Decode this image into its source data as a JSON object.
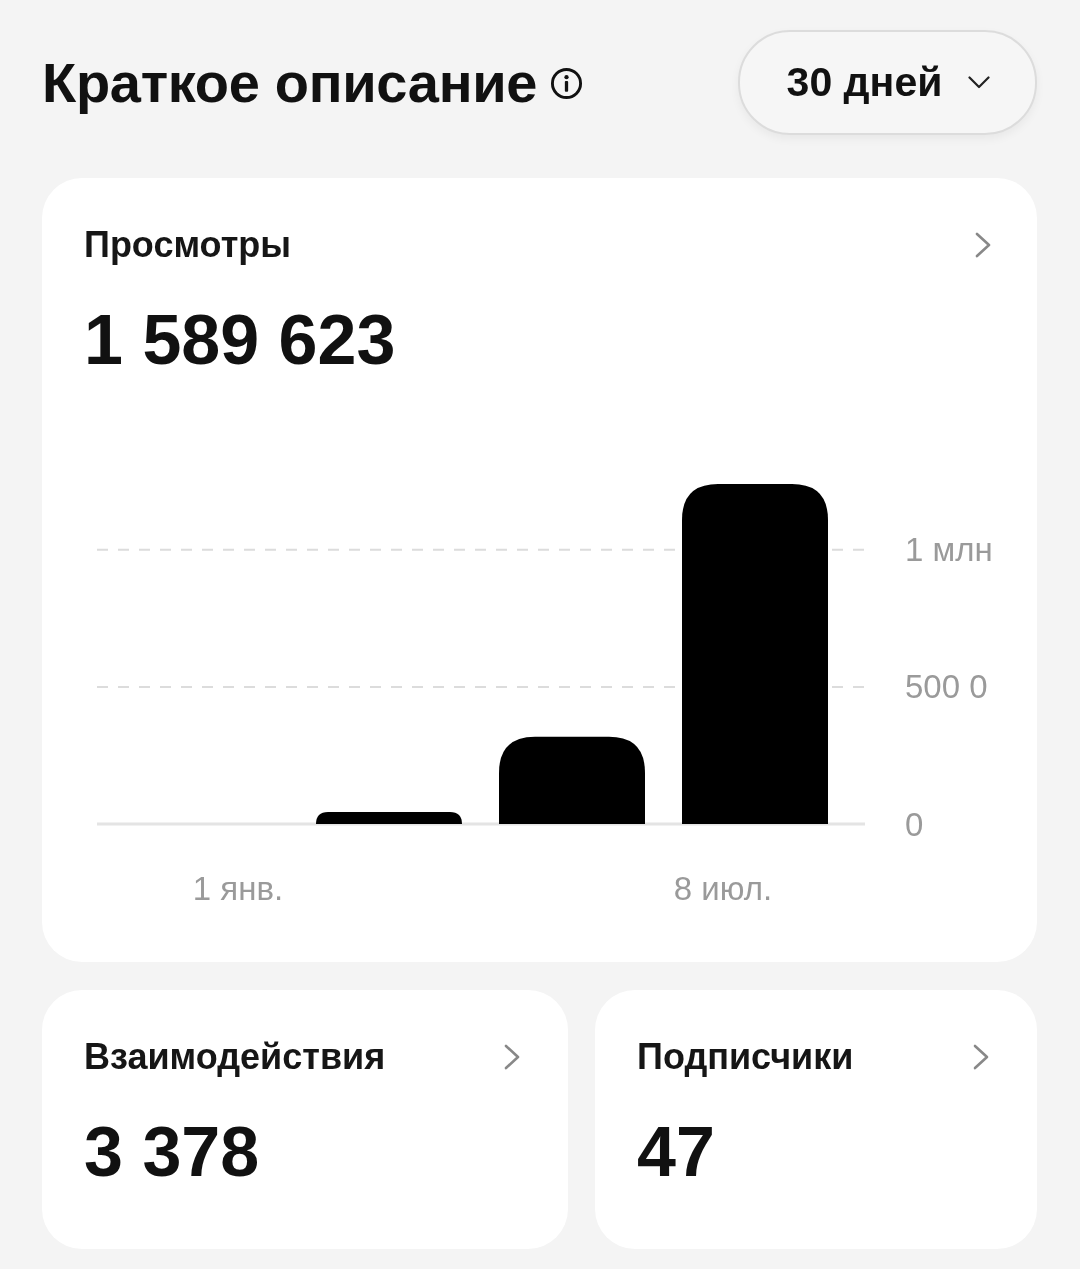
{
  "header": {
    "title": "Краткое описание",
    "period_dropdown": {
      "value": "30 дней"
    }
  },
  "views_card": {
    "title": "Просмотры",
    "value": "1 589 623",
    "chart_data": {
      "type": "bar",
      "categories": [
        "1 янв.",
        null,
        null,
        "8 июл."
      ],
      "values": [
        0,
        0.044,
        0.318,
        1.24
      ],
      "yticks": [
        0,
        {
          "value": 0.5,
          "label": "500 0"
        },
        {
          "value": 1,
          "label": "1 млн"
        }
      ],
      "ylim": [
        0,
        1.24
      ]
    }
  },
  "stat_cards": [
    {
      "title": "Взаимодействия",
      "value": "3 378"
    },
    {
      "title": "Подписчики",
      "value": "47"
    }
  ]
}
